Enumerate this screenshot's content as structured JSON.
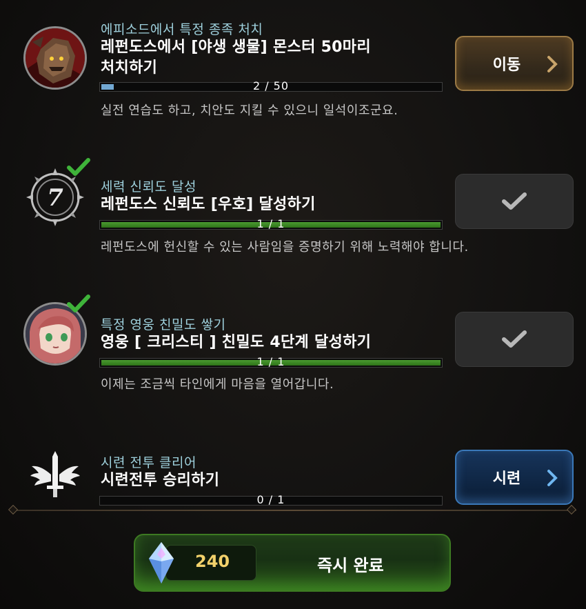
{
  "quests": [
    {
      "category": "에피소드에서 특정 종족 처치",
      "title_line1": "레펀도스에서 [야생 생물] 몬스터 50마리",
      "title_line2": "처치하기",
      "progress_text": "2 / 50",
      "progress_fraction": 0.04,
      "description": "실전 연습도 하고, 치안도 지킬 수 있으니 일석이조군요.",
      "button_label": "이동",
      "completed": false,
      "icon": "golem-portrait-icon"
    },
    {
      "category": "세력 신뢰도 달성",
      "title_line1": "레펀도스 신뢰도 [우호] 달성하기",
      "progress_text": "1 / 1",
      "progress_fraction": 1.0,
      "description": "레펀도스에 헌신할 수 있는 사람임을 증명하기 위해 노력해야 합니다.",
      "completed": true,
      "icon": "faction-emblem-7-icon"
    },
    {
      "category": "특정 영웅 친밀도 쌓기",
      "title_line1": "영웅 [ 크리스티 ] 친밀도 4단계 달성하기",
      "progress_text": "1 / 1",
      "progress_fraction": 1.0,
      "description": "이제는 조금씩 타인에게 마음을 열어갑니다.",
      "completed": true,
      "icon": "hero-christie-portrait-icon"
    },
    {
      "category": "시련 전투 클리어",
      "title_line1": "시련전투 승리하기",
      "progress_text": "0 / 1",
      "progress_fraction": 0.0,
      "button_label": "시련",
      "completed": false,
      "icon": "winged-sword-icon"
    }
  ],
  "instant_complete": {
    "cost": "240",
    "label": "즉시 완료",
    "currency_icon": "crystal-icon"
  },
  "colors": {
    "category_text": "#9ed0dc",
    "progress_done": "#3e8a24",
    "progress_partial": "#72a8d2",
    "cost_text": "#f2d16b",
    "check_green": "#3fb33a"
  }
}
